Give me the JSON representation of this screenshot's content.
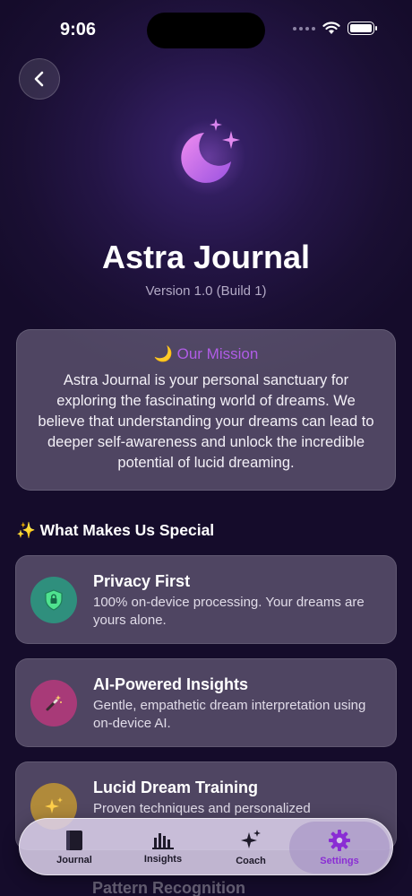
{
  "status_bar": {
    "time": "9:06"
  },
  "header": {
    "app_name": "Astra Journal",
    "version": "Version 1.0 (Build 1)"
  },
  "mission": {
    "title": "🌙 Our Mission",
    "body": "Astra Journal is your personal sanctuary for exploring the fascinating world of dreams. We believe that understanding your dreams can lead to deeper self-awareness and unlock the incredible potential of lucid dreaming."
  },
  "section": {
    "title": "✨ What Makes Us Special"
  },
  "features": [
    {
      "title": "Privacy First",
      "desc": "100% on-device processing. Your dreams are yours alone.",
      "icon": "shield-icon",
      "color": "#2f8f7d"
    },
    {
      "title": "AI-Powered Insights",
      "desc": "Gentle, empathetic dream interpretation using on-device AI.",
      "icon": "magic-wand-icon",
      "color": "#a83a78"
    },
    {
      "title": "Lucid Dream Training",
      "desc": "Proven techniques and personalized",
      "icon": "sparkles-icon",
      "color": "#b08a3a"
    }
  ],
  "peek_item": "Pattern Recognition",
  "tabs": [
    {
      "label": "Journal",
      "icon": "book-icon"
    },
    {
      "label": "Insights",
      "icon": "bar-chart-icon"
    },
    {
      "label": "Coach",
      "icon": "sparkle-icon"
    },
    {
      "label": "Settings",
      "icon": "gear-icon",
      "active": true
    }
  ],
  "colors": {
    "accent": "#8a2dd4",
    "mission_title": "#b05ce6"
  }
}
